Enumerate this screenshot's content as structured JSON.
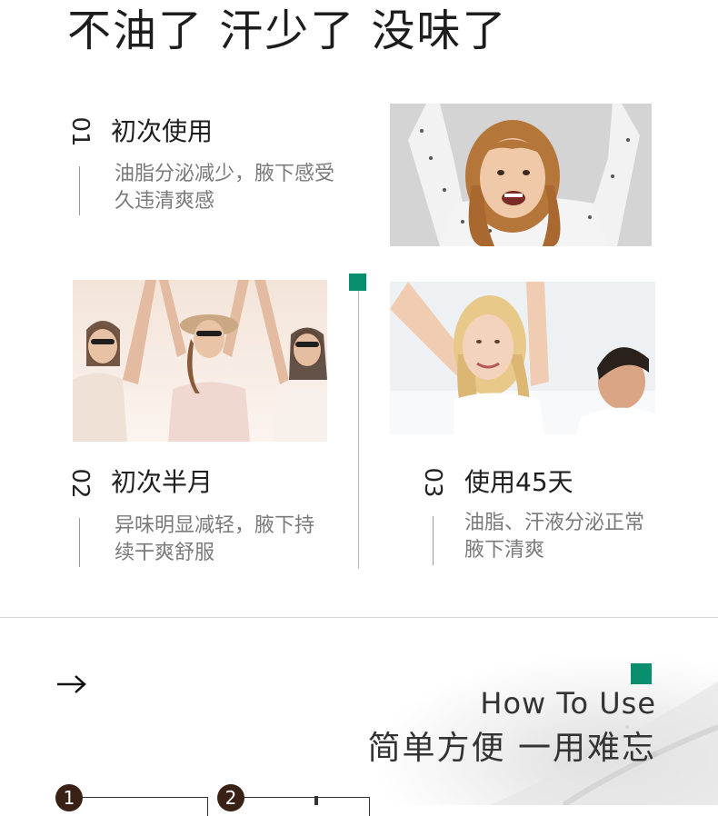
{
  "headline": "不油了 汗少了 没味了",
  "steps": [
    {
      "num": "01",
      "title": "初次使用",
      "desc_line1": "油脂分泌减少，腋下感受",
      "desc_line2": "久违清爽感"
    },
    {
      "num": "02",
      "title": "初次半月",
      "desc_line1": "异味明显减轻，腋下持",
      "desc_line2": "续干爽舒服"
    },
    {
      "num": "03",
      "title": "使用45天",
      "desc_line1": "油脂、汗液分泌正常",
      "desc_line2": "腋下清爽"
    }
  ],
  "how_to": {
    "en_title": "How To Use",
    "cn_title": "简单方便 一用难忘",
    "circle_1": "1",
    "circle_2": "2"
  },
  "colors": {
    "accent_green": "#0a8f6e",
    "circle_brown": "#3a2116"
  },
  "icons": {
    "arrow": "right-arrow-icon"
  }
}
